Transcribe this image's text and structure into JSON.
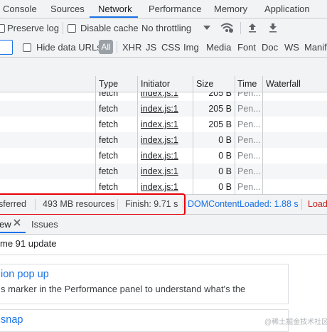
{
  "tabs": [
    "Console",
    "Sources",
    "Network",
    "Performance",
    "Memory",
    "Application"
  ],
  "toolbar1": {
    "preserve_log": "Preserve log",
    "disable_cache": "Disable cache",
    "throttling": "No throttling"
  },
  "toolbar2": {
    "hide_data_urls": "Hide data URLs",
    "all": "All",
    "filters": [
      "XHR",
      "JS",
      "CSS",
      "Img",
      "Media",
      "Font",
      "Doc",
      "WS",
      "Manif"
    ]
  },
  "table": {
    "headers": [
      "Type",
      "Initiator",
      "Size",
      "Time",
      "Waterfall"
    ],
    "partial_row": {
      "type": "fetch",
      "initiator": "index.js:1",
      "size": "205 B",
      "time": "Pen..."
    },
    "rows": [
      {
        "type": "fetch",
        "initiator": "index.js:1",
        "size": "205 B",
        "time": "Pen..."
      },
      {
        "type": "fetch",
        "initiator": "index.js:1",
        "size": "205 B",
        "time": "Pen..."
      },
      {
        "type": "fetch",
        "initiator": "index.js:1",
        "size": "0 B",
        "time": "Pen..."
      },
      {
        "type": "fetch",
        "initiator": "index.js:1",
        "size": "0 B",
        "time": "Pen..."
      },
      {
        "type": "fetch",
        "initiator": "index.js:1",
        "size": "0 B",
        "time": "Pen..."
      },
      {
        "type": "fetch",
        "initiator": "index.js:1",
        "size": "0 B",
        "time": "Pen..."
      }
    ]
  },
  "status": {
    "transferred": "sferred",
    "resources": "493 MB resources",
    "finish": "Finish: 9.71 s",
    "dom_content_loaded": "DOMContentLoaded: 1.88 s",
    "load": "Load"
  },
  "drawer": {
    "tab_whatsnew": "ew",
    "tab_issues": "Issues"
  },
  "whatsnew": {
    "title": "me 91 update",
    "card1_title": "ion pop up",
    "card1_text": "s marker in the Performance panel to understand what's the",
    "card2_title": "snap"
  },
  "watermark": "@稀土掘金技术社区",
  "colors": {
    "accent": "#1a73e8",
    "highlight_box": "#e8000a",
    "load_text": "#c5221f"
  }
}
